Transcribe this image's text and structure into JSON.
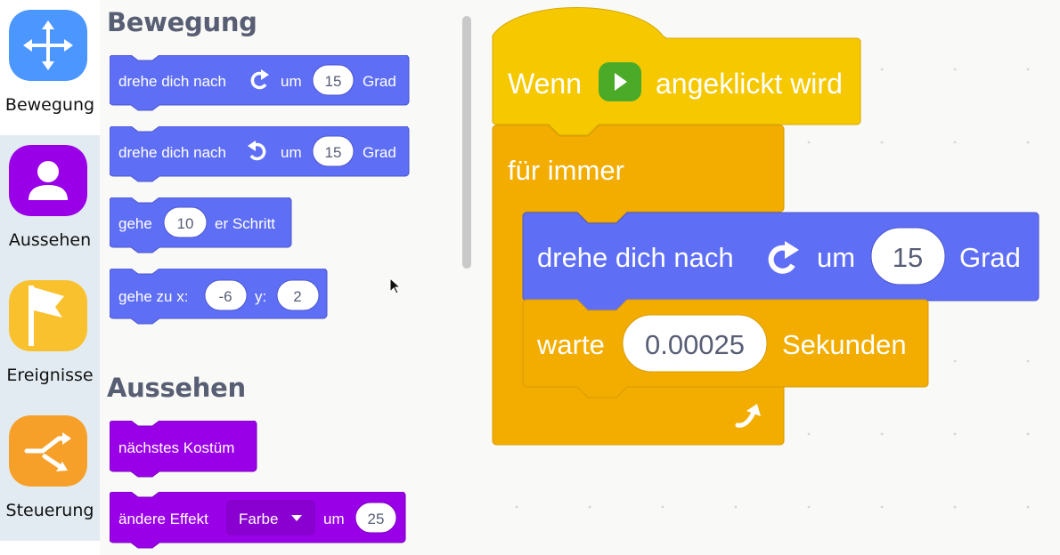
{
  "sidebar": {
    "categories": [
      {
        "label": "Bewegung",
        "color": "#4c97ff",
        "icon": "move-arrows-icon"
      },
      {
        "label": "Aussehen",
        "color": "#9a00e8",
        "icon": "person-icon"
      },
      {
        "label": "Ereignisse",
        "color": "#f9c12e",
        "icon": "flag-icon"
      },
      {
        "label": "Steuerung",
        "color": "#f6a02a",
        "icon": "shuffle-icon"
      }
    ]
  },
  "palette": {
    "motion_title": "Bewegung",
    "looks_title": "Aussehen",
    "turn_right": {
      "text1": "drehe dich nach",
      "text2": "um",
      "value": "15",
      "text3": "Grad"
    },
    "turn_left": {
      "text1": "drehe dich nach",
      "text2": "um",
      "value": "15",
      "text3": "Grad"
    },
    "move": {
      "text1": "gehe",
      "value": "10",
      "text2": "er Schritt"
    },
    "goto": {
      "text1": "gehe zu x:",
      "x": "-6",
      "text2": "y:",
      "y": "2"
    },
    "next_costume": {
      "text": "nächstes Kostüm"
    },
    "change_effect": {
      "text1": "ändere Effekt",
      "dropdown": "Farbe",
      "text2": "um",
      "value": "25"
    }
  },
  "script": {
    "hat": {
      "text1": "Wenn",
      "text2": "angeklickt wird"
    },
    "forever": {
      "text": "für immer"
    },
    "turn": {
      "text1": "drehe dich nach",
      "text2": "um",
      "value": "15",
      "text3": "Grad"
    },
    "wait": {
      "text1": "warte",
      "value": "0.00025",
      "text2": "Sekunden"
    }
  },
  "colors": {
    "motion": "#5f6ff5",
    "motion_border": "#4b55cc",
    "looks": "#9a00e8",
    "looks_border": "#7c00bf",
    "events": "#f5c800",
    "events_border": "#d7a900",
    "control": "#f2ad00",
    "control_border": "#d99a00",
    "green_flag_bg": "#4bab29"
  }
}
